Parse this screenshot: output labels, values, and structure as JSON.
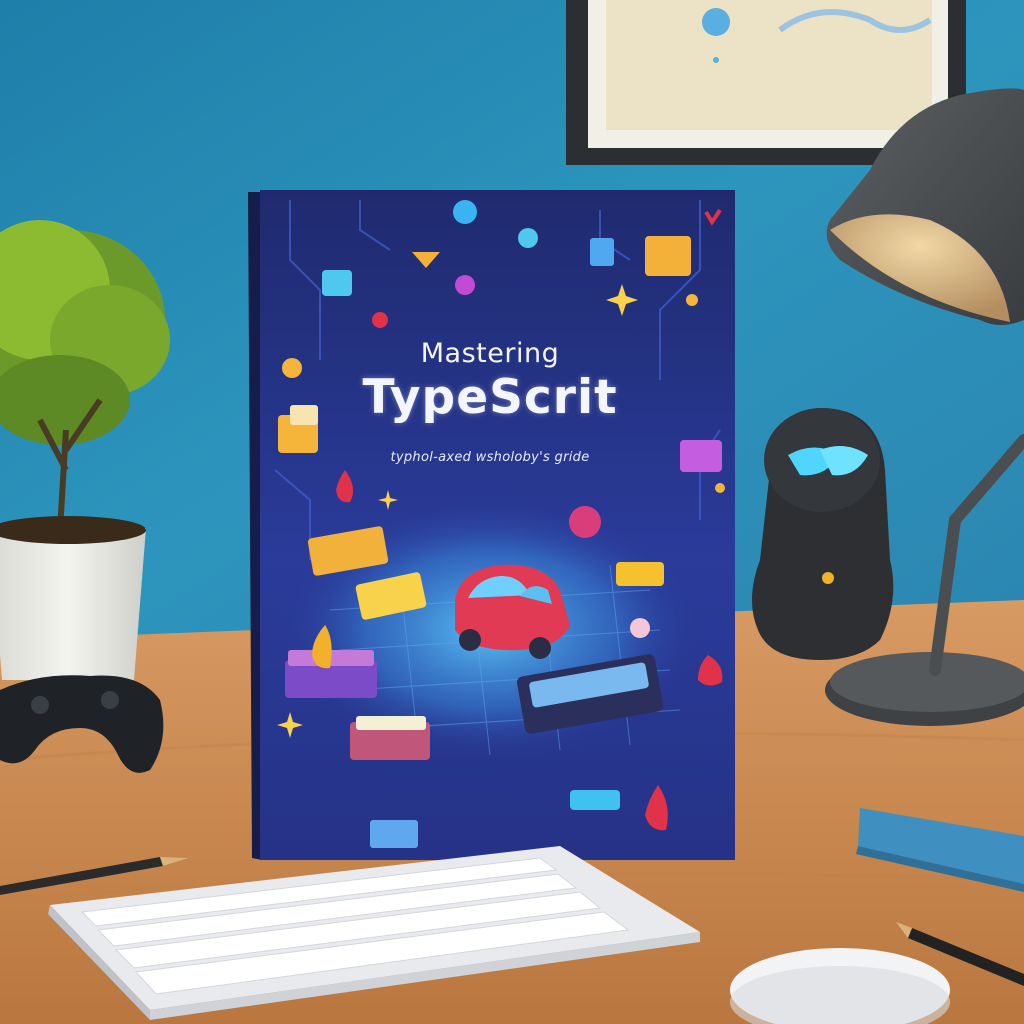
{
  "book": {
    "title_line_1": "Mastering",
    "title_line_2": "TypeScrit",
    "subtitle": "typhol-axed wsholoby's gride"
  },
  "colors": {
    "wall": "#2b8fb6",
    "desk": "#c98a55",
    "book_cover": "#25317e",
    "car": "#e03a55",
    "robot_eyes": "#4fd6ff"
  }
}
